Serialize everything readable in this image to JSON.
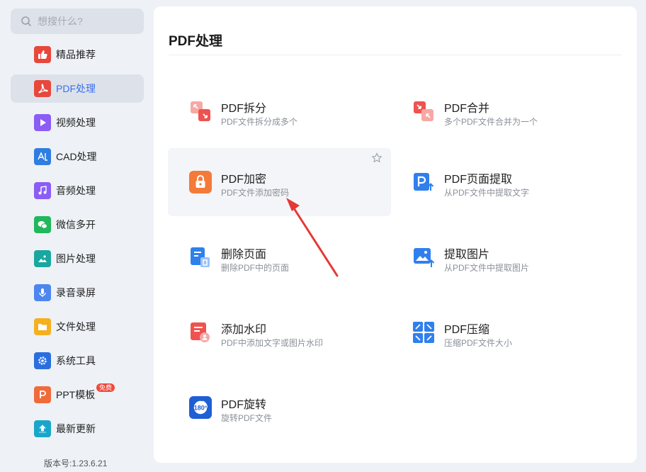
{
  "search": {
    "placeholder": "想搜什么?"
  },
  "sidebar": {
    "items": [
      {
        "label": "精品推荐",
        "icon": "thumbs-up-icon",
        "color": "#e8473b"
      },
      {
        "label": "PDF处理",
        "icon": "pdf-icon",
        "color": "#e8473b",
        "active": true
      },
      {
        "label": "视频处理",
        "icon": "play-icon",
        "color": "#8b5cf6"
      },
      {
        "label": "CAD处理",
        "icon": "cad-icon",
        "color": "#2f7de1"
      },
      {
        "label": "音频处理",
        "icon": "music-icon",
        "color": "#8b5cf6"
      },
      {
        "label": "微信多开",
        "icon": "wechat-icon",
        "color": "#1fb85b"
      },
      {
        "label": "图片处理",
        "icon": "image-icon",
        "color": "#19a7a0"
      },
      {
        "label": "录音录屏",
        "icon": "microphone-icon",
        "color": "#4e86f0"
      },
      {
        "label": "文件处理",
        "icon": "folder-icon",
        "color": "#f5b01f"
      },
      {
        "label": "系统工具",
        "icon": "gear-icon",
        "color": "#2a6fdd"
      },
      {
        "label": "PPT模板",
        "icon": "ppt-icon",
        "color": "#ef6b3a",
        "badge": "免费"
      },
      {
        "label": "最新更新",
        "icon": "upload-icon",
        "color": "#19a7c9"
      }
    ]
  },
  "version": "版本号:1.23.6.21",
  "main": {
    "title": "PDF处理",
    "tools": [
      {
        "title": "PDF拆分",
        "desc": "PDF文件拆分成多个",
        "icon": "pdf-split-icon",
        "color": "#ef5350"
      },
      {
        "title": "PDF合并",
        "desc": "多个PDF文件合并为一个",
        "icon": "pdf-merge-icon",
        "color": "#ef5350"
      },
      {
        "title": "PDF加密",
        "desc": "PDF文件添加密码",
        "icon": "lock-icon",
        "color": "#f47a3a",
        "hover": true
      },
      {
        "title": "PDF页面提取",
        "desc": "从PDF文件中提取文字",
        "icon": "page-extract-icon",
        "color": "#2f80ed"
      },
      {
        "title": "删除页面",
        "desc": "删除PDF中的页面",
        "icon": "delete-page-icon",
        "color": "#2f80ed"
      },
      {
        "title": "提取图片",
        "desc": "从PDF文件中提取图片",
        "icon": "extract-image-icon",
        "color": "#2f80ed"
      },
      {
        "title": "添加水印",
        "desc": "PDF中添加文字或图片水印",
        "icon": "watermark-icon",
        "color": "#ef5350"
      },
      {
        "title": "PDF压缩",
        "desc": "压缩PDF文件大小",
        "icon": "compress-icon",
        "color": "#2f80ed"
      },
      {
        "title": "PDF旋转",
        "desc": "旋转PDF文件",
        "icon": "rotate-icon",
        "color": "#1f5fd6"
      }
    ]
  }
}
